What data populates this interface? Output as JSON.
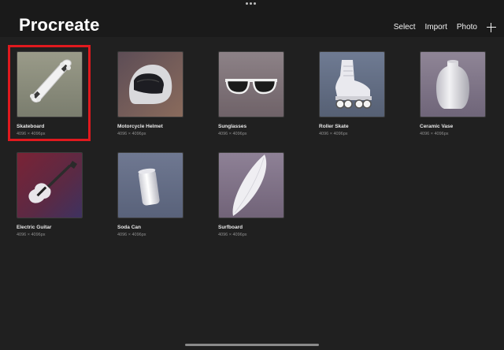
{
  "app": {
    "title": "Procreate"
  },
  "toolbar": {
    "select_label": "Select",
    "import_label": "Import",
    "photo_label": "Photo"
  },
  "artworks": [
    {
      "name": "Skateboard",
      "dims": "4096 × 4096px",
      "selected": true
    },
    {
      "name": "Motorcycle Helmet",
      "dims": "4096 × 4096px"
    },
    {
      "name": "Sunglasses",
      "dims": "4096 × 4096px"
    },
    {
      "name": "Roller Skate",
      "dims": "4096 × 4096px"
    },
    {
      "name": "Ceramic Vase",
      "dims": "4096 × 4096px"
    },
    {
      "name": "Electric Guitar",
      "dims": "4096 × 4096px"
    },
    {
      "name": "Soda Can",
      "dims": "4096 × 4096px"
    },
    {
      "name": "Surfboard",
      "dims": "4096 × 4096px"
    }
  ],
  "colors": {
    "selection": "#e0191e",
    "background": "#202020"
  }
}
